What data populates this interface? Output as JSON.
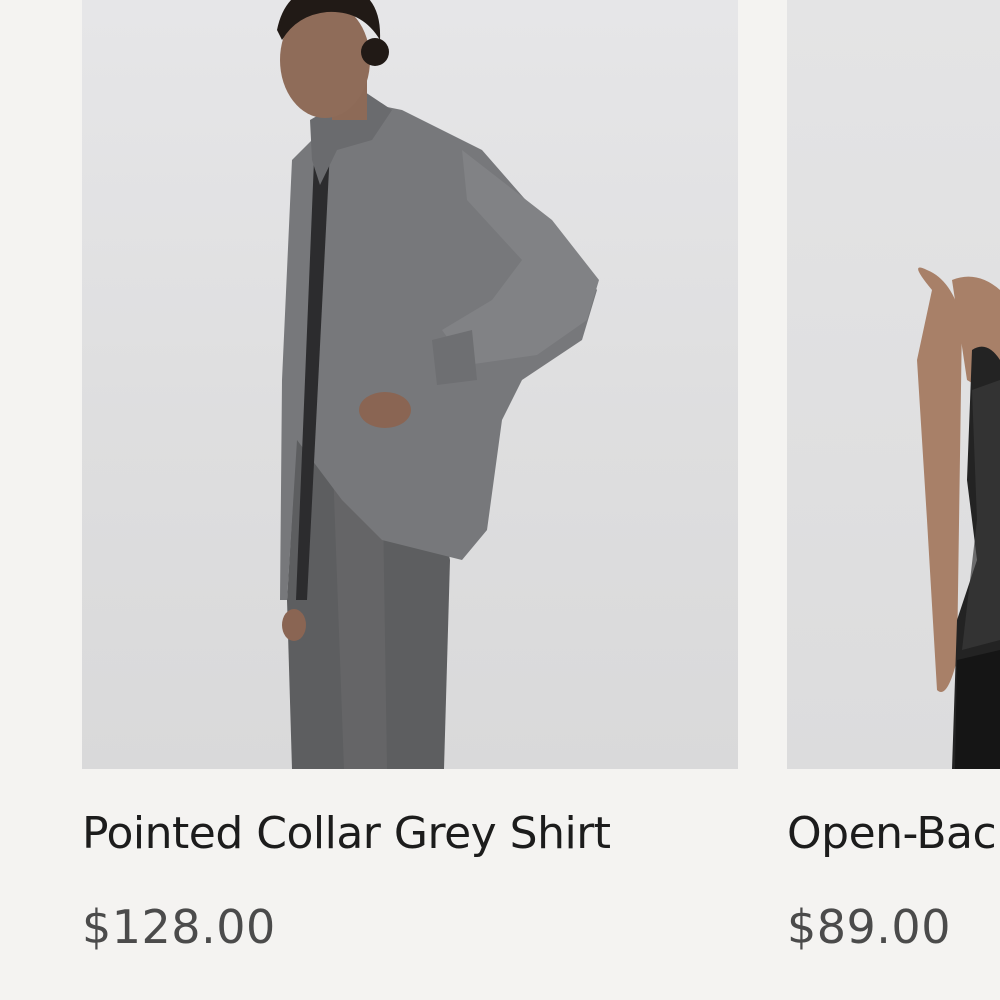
{
  "products": [
    {
      "title": "Pointed Collar Grey Shirt",
      "price": "$128.00",
      "image_alt": "Model wearing oversized grey shirt and grey trousers"
    },
    {
      "title": "Open-Bac",
      "price": "$89.00",
      "image_alt": "Model wearing black open-back top"
    }
  ],
  "colors": {
    "background": "#f4f3f1",
    "title": "#1c1c1c",
    "price": "#4b4b4b"
  }
}
